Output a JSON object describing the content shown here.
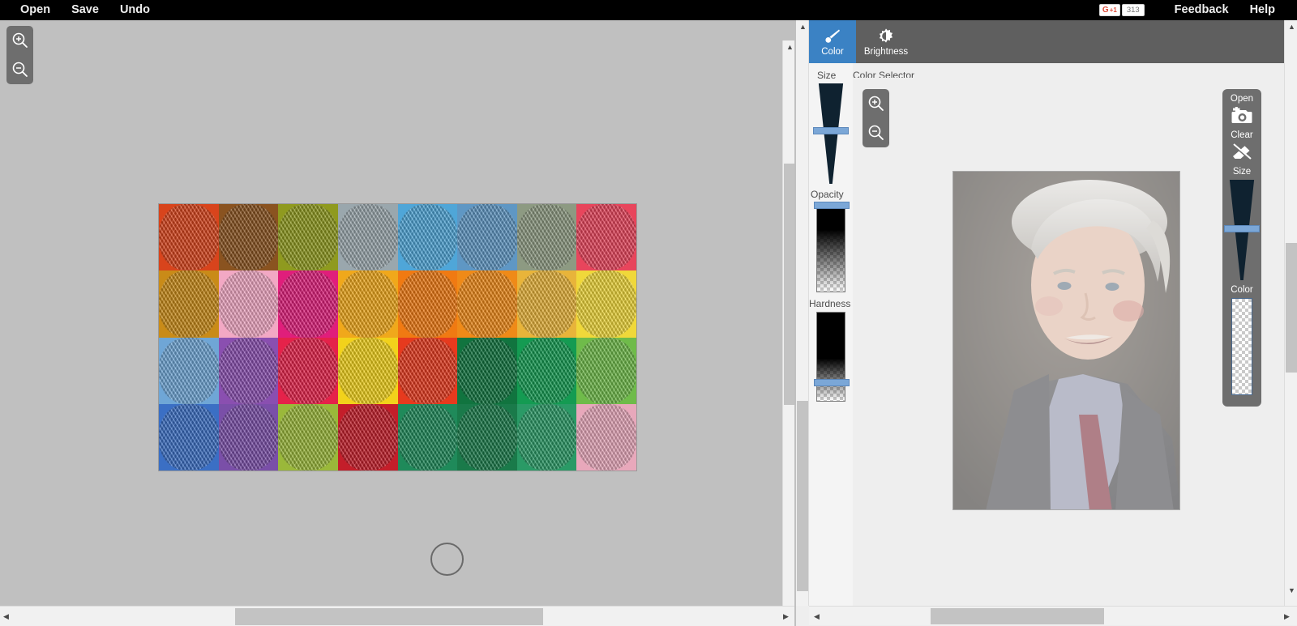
{
  "topbar": {
    "left_items": [
      {
        "label": "Open",
        "name": "menu-open"
      },
      {
        "label": "Save",
        "name": "menu-save"
      },
      {
        "label": "Undo",
        "name": "menu-undo"
      }
    ],
    "gplus": {
      "g": "G",
      "plus": "+1",
      "count": "313"
    },
    "right_items": [
      {
        "label": "Feedback",
        "name": "menu-feedback"
      },
      {
        "label": "Help",
        "name": "menu-help"
      }
    ]
  },
  "canvas": {
    "zoom_in_icon": "zoom-in-icon",
    "zoom_out_icon": "zoom-out-icon",
    "image_name": "colorful-yarn-balls-photo",
    "brush_cursor": "brush-cursor-circle"
  },
  "panel": {
    "tabs": [
      {
        "label": "Color",
        "icon": "paintbrush-icon",
        "active": true
      },
      {
        "label": "Brightness",
        "icon": "brightness-contrast-icon",
        "active": false
      }
    ],
    "sliders_header": "Size",
    "color_selector_header": "Color Selector",
    "sliders": [
      {
        "label": "Size",
        "name": "size-slider",
        "thumb_pct": 45
      },
      {
        "label": "Opacity",
        "name": "opacity-slider",
        "thumb_pct": 2
      },
      {
        "label": "Hardness",
        "name": "hardness-slider",
        "thumb_pct": 78
      }
    ],
    "zoom_in_icon": "zoom-in-icon",
    "zoom_out_icon": "zoom-out-icon",
    "preview_image_name": "portrait-photo"
  },
  "tool_palette": {
    "open_label": "Open",
    "open_icon": "add-photo-icon",
    "clear_label": "Clear",
    "clear_icon": "eraser-slash-icon",
    "size_label": "Size",
    "size_thumb_pct": 46,
    "color_label": "Color",
    "color_value": "transparent-checker"
  },
  "colors": {
    "accent": "#3b82c4",
    "panel_gray": "#6e6e6e",
    "topbar_bg": "#000000",
    "app_bg": "#c0c0c0",
    "slider_thumb": "#7ba7d7"
  },
  "yarn_palette": [
    [
      "#d8441c",
      "#8a5320",
      "#8f9a1f",
      "#9aa7ad",
      "#4fa6d8",
      "#5f97c4",
      "#8d9a82",
      "#e8455c"
    ],
    [
      "#c98b18",
      "#f2a8c4",
      "#e01e7b",
      "#f0a81b",
      "#f07a12",
      "#ef8a18",
      "#e8b43a",
      "#f0d83a"
    ],
    [
      "#6fa6d6",
      "#8a4fb0",
      "#e5224a",
      "#f2d21b",
      "#e63a1e",
      "#11743f",
      "#149b52",
      "#6fbb4a"
    ],
    [
      "#3b6fc4",
      "#7a4fa8",
      "#9ab83a",
      "#c41e2a",
      "#1f8a5a",
      "#1a7a4a",
      "#2a9a66",
      "#e8a8bb"
    ]
  ]
}
